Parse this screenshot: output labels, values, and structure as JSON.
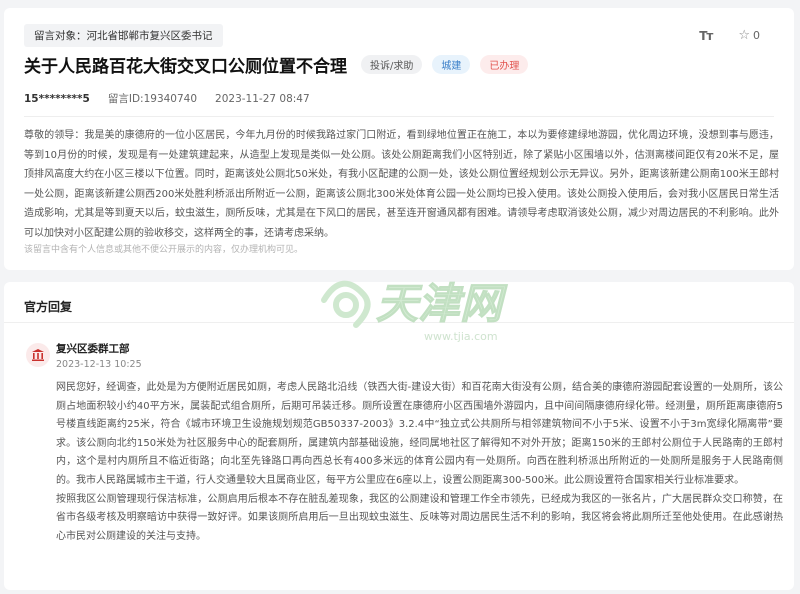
{
  "complaint": {
    "target_label": "留言对象：河北省邯郸市复兴区委书记",
    "tools": {
      "font_icon": "font-size-icon",
      "star_icon": "star-icon",
      "star_count": "0"
    },
    "title": "关于人民路百花大街交叉口公厕位置不合理",
    "badges": {
      "type": "投诉/求助",
      "category": "城建",
      "status": "已办理"
    },
    "meta": {
      "user": "15********5",
      "id": "留言ID:19340740",
      "time": "2023-11-27 08:47"
    },
    "body": "尊敬的领导：我是美的康德府的一位小区居民，今年九月份的时候我路过家门口附近，看到绿地位置正在施工，本以为要修建绿地游园，优化周边环境，没想到事与愿违，等到10月份的时候，发现是有一处建筑建起来，从造型上发现是类似一处公厕。该处公厕距离我们小区特别近，除了紧贴小区围墙以外，估测离楼间距仅有20米不足，屋顶排风高度大约在小区三楼以下位置。同时，距离该处公厕北50米处，有我小区配建的公厕一处，该处公厕位置经规划公示无异议。另外，距离该新建公厕南100米王郎村一处公厕，距离该新建公厕西200米处胜利桥派出所附近一公厕，距离该公厕北300米处体育公园一处公厕均已投入使用。该处公厕投入使用后，会对我小区居民日常生活造成影响，尤其是等到夏天以后，蚊虫滋生，厕所反味，尤其是在下风口的居民，甚至连开窗通风都有困难。请领导考虑取消该处公厕，减少对周边居民的不利影响。此外可以加快对小区配建公厕的验收移交，这样两全的事，还请考虑采纳。",
    "disclaimer": "该留言中含有个人信息或其他不便公开展示的内容，仅办理机构可见。"
  },
  "reply": {
    "header": "官方回复",
    "department": "复兴区委群工部",
    "date": "2023-12-13 10:25",
    "watermark": "www.tjia.com",
    "paragraphs": [
      "网民您好，经调查，此处是为方便附近居民如厕，考虑人民路北沿线（铁西大街-建设大街）和百花南大街没有公厕，结合美的康德府游园配套设置的一处厕所，该公厕占地面积较小约40平方米，属装配式组合厕所，后期可吊装迁移。厕所设置在康德府小区西围墙外游园内，且中间间隔康德府绿化带。经测量，厕所距离康德府5号楼直线距离约25米，符合《城市环境卫生设施规划规范GB50337-2003》3.2.4中“独立式公共厕所与相邻建筑物间不小于5米、设置不小于3m宽绿化隔离带”要求。该公厕向北约150米处为社区服务中心的配套厕所，属建筑内部基础设施，经同属地社区了解得知不对外开放；距离150米的王郎村公厕位于人民路南的王郎村内，这个是村内厕所且不临近街路；向北至先锋路口再向西总长有400多米远的体育公园内有一处厕所。向西在胜利桥派出所附近的一处厕所是服务于人民路南侧的。我市人民路属城市主干道，行人交通量较大且属商业区，每平方公里应在6座以上，设置公厕距离300-500米。此公厕设置符合国家相关行业标准要求。",
      "按照我区公厕管理现行保洁标准，公厕启用后根本不存在脏乱差现象，我区的公厕建设和管理工作全市领先，已经成为我区的一张名片，广大居民群众交口称赞，在省市各级考核及明察暗访中获得一致好评。如果该厕所启用后一旦出现蚊虫滋生、反味等对周边居民生活不利的影响，我区将会将此厕所迁至他处使用。在此感谢热心市民对公厕建设的关注与支持。"
    ]
  }
}
